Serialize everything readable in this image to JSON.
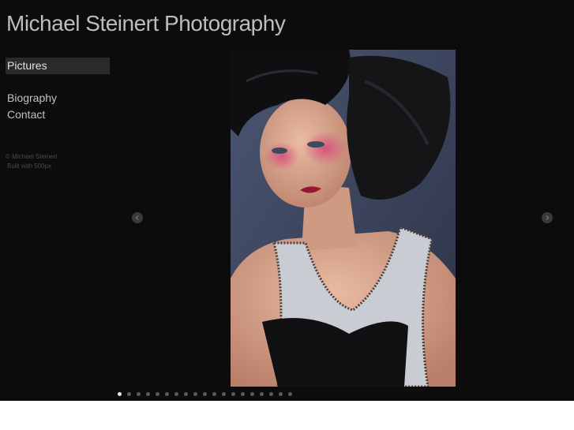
{
  "site": {
    "title": "Michael Steinert Photography"
  },
  "nav": {
    "items": [
      {
        "label": "Pictures",
        "active": true
      },
      {
        "label": "Biography",
        "active": false
      },
      {
        "label": "Contact",
        "active": false
      }
    ]
  },
  "footer": {
    "copyright": "© Michael Steinert",
    "built_with": "Built with 500px"
  },
  "gallery": {
    "prev_icon": "chevron-left-icon",
    "next_icon": "chevron-right-icon",
    "slide_count": 19,
    "current_slide": 1
  },
  "colors": {
    "background": "#0c0c0d",
    "active_nav": "#2a2a2a",
    "text": "#c2c2c2"
  }
}
